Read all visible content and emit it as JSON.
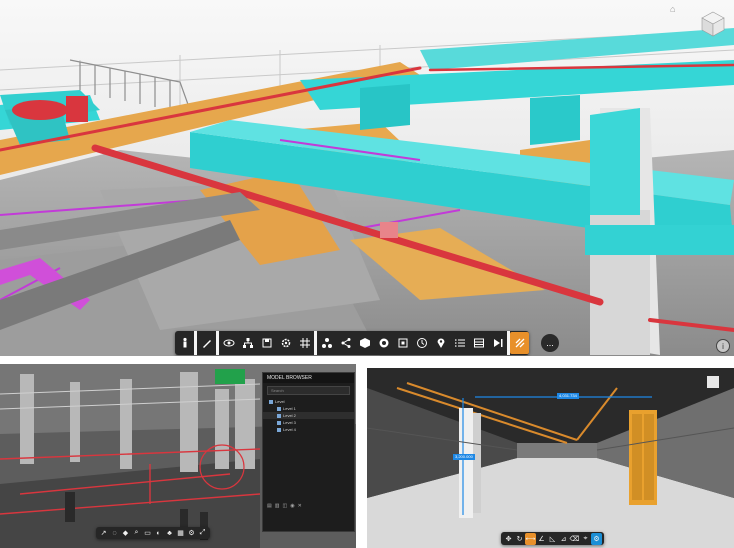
{
  "colors": {
    "duct": "#35d6d6",
    "pipe_red": "#d9363e",
    "orange_panel": "#e6a74d",
    "magenta": "#c23bd8",
    "toolbar_bg": "#262626",
    "active_orange": "#e8902a",
    "active_blue": "#1b8fd6"
  },
  "main_view": {
    "toolbar": {
      "tools": [
        {
          "name": "walk",
          "icon": "person-icon"
        },
        {
          "name": "markup",
          "icon": "pen-icon"
        },
        {
          "name": "view",
          "icon": "eye-icon"
        },
        {
          "name": "structure",
          "icon": "hierarchy-icon"
        },
        {
          "name": "save",
          "icon": "disk-icon"
        },
        {
          "name": "settings",
          "icon": "gear-icon"
        },
        {
          "name": "section",
          "icon": "grid-icon"
        },
        {
          "name": "model-tree",
          "icon": "tree-icon"
        },
        {
          "name": "share",
          "icon": "share-icon"
        },
        {
          "name": "layers",
          "icon": "cube-icon"
        },
        {
          "name": "camera",
          "icon": "camera-icon"
        },
        {
          "name": "fit",
          "icon": "frame-icon"
        },
        {
          "name": "history",
          "icon": "clock-icon"
        },
        {
          "name": "location",
          "icon": "pin-icon"
        },
        {
          "name": "list",
          "icon": "list-icon"
        },
        {
          "name": "table",
          "icon": "table-icon"
        },
        {
          "name": "media",
          "icon": "play-icon"
        },
        {
          "name": "bim",
          "icon": "bim-icon"
        }
      ],
      "more_label": "..."
    }
  },
  "model_browser": {
    "title": "MODEL BROWSER",
    "search": "Search",
    "root": "Level",
    "children": [
      "Level 1",
      "Level 2",
      "Level 3",
      "Level 4"
    ]
  },
  "measure_view": {
    "dimension_1": "4,031.734",
    "dimension_2": "3,200.000"
  }
}
